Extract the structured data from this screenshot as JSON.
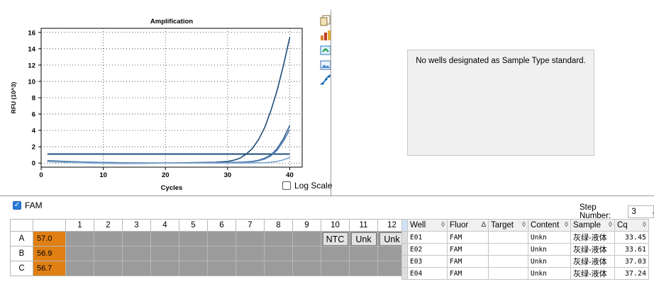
{
  "chart_data": {
    "type": "line",
    "title": "Amplification",
    "xlabel": "Cycles",
    "ylabel": "RFU (10^3)",
    "xlim": [
      0,
      42
    ],
    "ylim": [
      -0.5,
      16.5
    ],
    "xticks": [
      0,
      10,
      20,
      30,
      40
    ],
    "yticks": [
      0,
      2,
      4,
      6,
      8,
      10,
      12,
      14,
      16
    ],
    "grid": true,
    "threshold": 1.1,
    "series": [
      {
        "color": "#1f4e79",
        "x": [
          1,
          4,
          8,
          12,
          16,
          20,
          24,
          28,
          30,
          31,
          32,
          33,
          34,
          35,
          36,
          37,
          38,
          39,
          40
        ],
        "y": [
          0.2,
          0.1,
          0.05,
          0.0,
          0.0,
          0.0,
          0.05,
          0.1,
          0.2,
          0.35,
          0.6,
          1.1,
          1.8,
          2.9,
          4.4,
          6.5,
          9.0,
          12.0,
          15.4
        ]
      },
      {
        "color": "#2f5f94",
        "x": [
          1,
          4,
          8,
          12,
          16,
          20,
          24,
          28,
          32,
          34,
          35,
          36,
          37,
          38,
          39,
          40
        ],
        "y": [
          0.3,
          0.2,
          0.1,
          0.05,
          0.0,
          0.0,
          0.0,
          0.05,
          0.1,
          0.2,
          0.35,
          0.6,
          1.0,
          1.8,
          3.0,
          4.6
        ]
      },
      {
        "color": "#5b86b8",
        "x": [
          1,
          4,
          8,
          12,
          16,
          20,
          24,
          28,
          32,
          34,
          35,
          36,
          37,
          38,
          39,
          40
        ],
        "y": [
          0.25,
          0.15,
          0.1,
          0.05,
          0.0,
          0.0,
          0.0,
          0.05,
          0.1,
          0.15,
          0.3,
          0.5,
          0.9,
          1.6,
          2.7,
          4.1
        ]
      },
      {
        "color": "#7da4cf",
        "x": [
          1,
          4,
          8,
          12,
          16,
          20,
          24,
          28,
          32,
          36,
          37,
          38,
          39,
          40
        ],
        "y": [
          0.2,
          0.1,
          0.0,
          -0.05,
          -0.05,
          0.0,
          0.0,
          0.0,
          0.0,
          0.05,
          0.1,
          0.2,
          0.4,
          0.7
        ]
      }
    ]
  },
  "toolbar": {
    "icons": [
      "copy-icon",
      "export-chart-icon",
      "refresh-icon",
      "image-icon",
      "curve-fit-icon"
    ]
  },
  "std_panel": {
    "message": "No wells designated as Sample Type standard."
  },
  "log_scale": {
    "label": "Log Scale",
    "checked": false
  },
  "fluor_filter": {
    "label": "FAM",
    "checked": true
  },
  "step": {
    "label": "Step Number:",
    "value": "3"
  },
  "plate": {
    "columns": [
      "1",
      "2",
      "3",
      "4",
      "5",
      "6",
      "7",
      "8",
      "9",
      "10",
      "11",
      "12"
    ],
    "rows": [
      {
        "label": "A",
        "temp": "57.0",
        "wells": [
          "",
          "",
          "",
          "",
          "",
          "",
          "",
          "",
          "",
          "NTC",
          "Unk",
          "Unk"
        ]
      },
      {
        "label": "B",
        "temp": "56.9",
        "wells": [
          "",
          "",
          "",
          "",
          "",
          "",
          "",
          "",
          "",
          "",
          "",
          ""
        ]
      },
      {
        "label": "C",
        "temp": "56.7",
        "wells": [
          "",
          "",
          "",
          "",
          "",
          "",
          "",
          "",
          "",
          "",
          "",
          ""
        ]
      }
    ]
  },
  "results": {
    "headers": [
      "Well",
      "Fluor",
      "Target",
      "Content",
      "Sample",
      "Cq"
    ],
    "sort_glyphs": [
      "◊",
      "∆",
      "◊",
      "◊",
      "◊",
      "◊"
    ],
    "rows": [
      [
        "E01",
        "FAM",
        "",
        "Unkn",
        "灰绿-液体",
        "33.45"
      ],
      [
        "E02",
        "FAM",
        "",
        "Unkn",
        "灰绿-液体",
        "33.61"
      ],
      [
        "E03",
        "FAM",
        "",
        "Unkn",
        "灰绿-液体",
        "37.03"
      ],
      [
        "E04",
        "FAM",
        "",
        "Unkn",
        "灰绿-液体",
        "37.24"
      ]
    ]
  }
}
